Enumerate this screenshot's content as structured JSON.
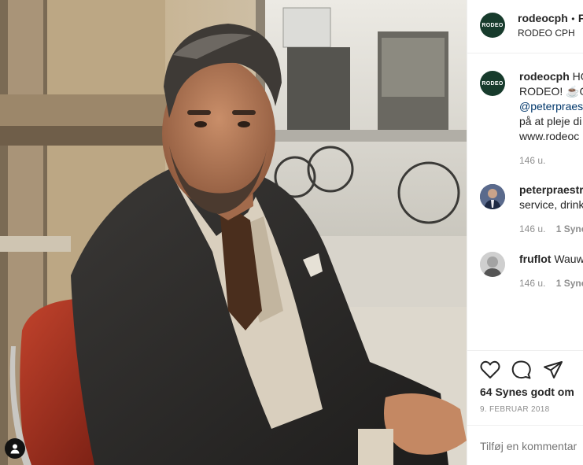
{
  "header": {
    "username": "rodeocph",
    "separator": "•",
    "follow_label": "F",
    "subtitle": "RODEO CPH",
    "avatar_text": "RODEO"
  },
  "caption": {
    "username": "rodeocph",
    "line1": "HO",
    "line2": "RODEO! ☕G",
    "mention": "@peterpraes",
    "line4": "på at pleje di",
    "line5": "www.rodeoc",
    "time": "146 u."
  },
  "comments": [
    {
      "username": "peterpraestr",
      "text": "service, drink",
      "time": "146 u.",
      "likes": "1 Syne"
    },
    {
      "username": "fruflot",
      "text": "Wauw",
      "time": "146 u.",
      "likes": "1 Syne"
    }
  ],
  "actions": {
    "likes": "64 Synes godt om",
    "date": "9. FEBRUAR 2018"
  },
  "comment_box": {
    "placeholder": "Tilføj en kommentar"
  },
  "colors": {
    "brand_green": "#173b2c",
    "link_blue": "#00376b",
    "meta_gray": "#8e8e8e"
  },
  "icons": [
    "heart-icon",
    "comment-icon",
    "share-icon",
    "user-tag-icon"
  ]
}
